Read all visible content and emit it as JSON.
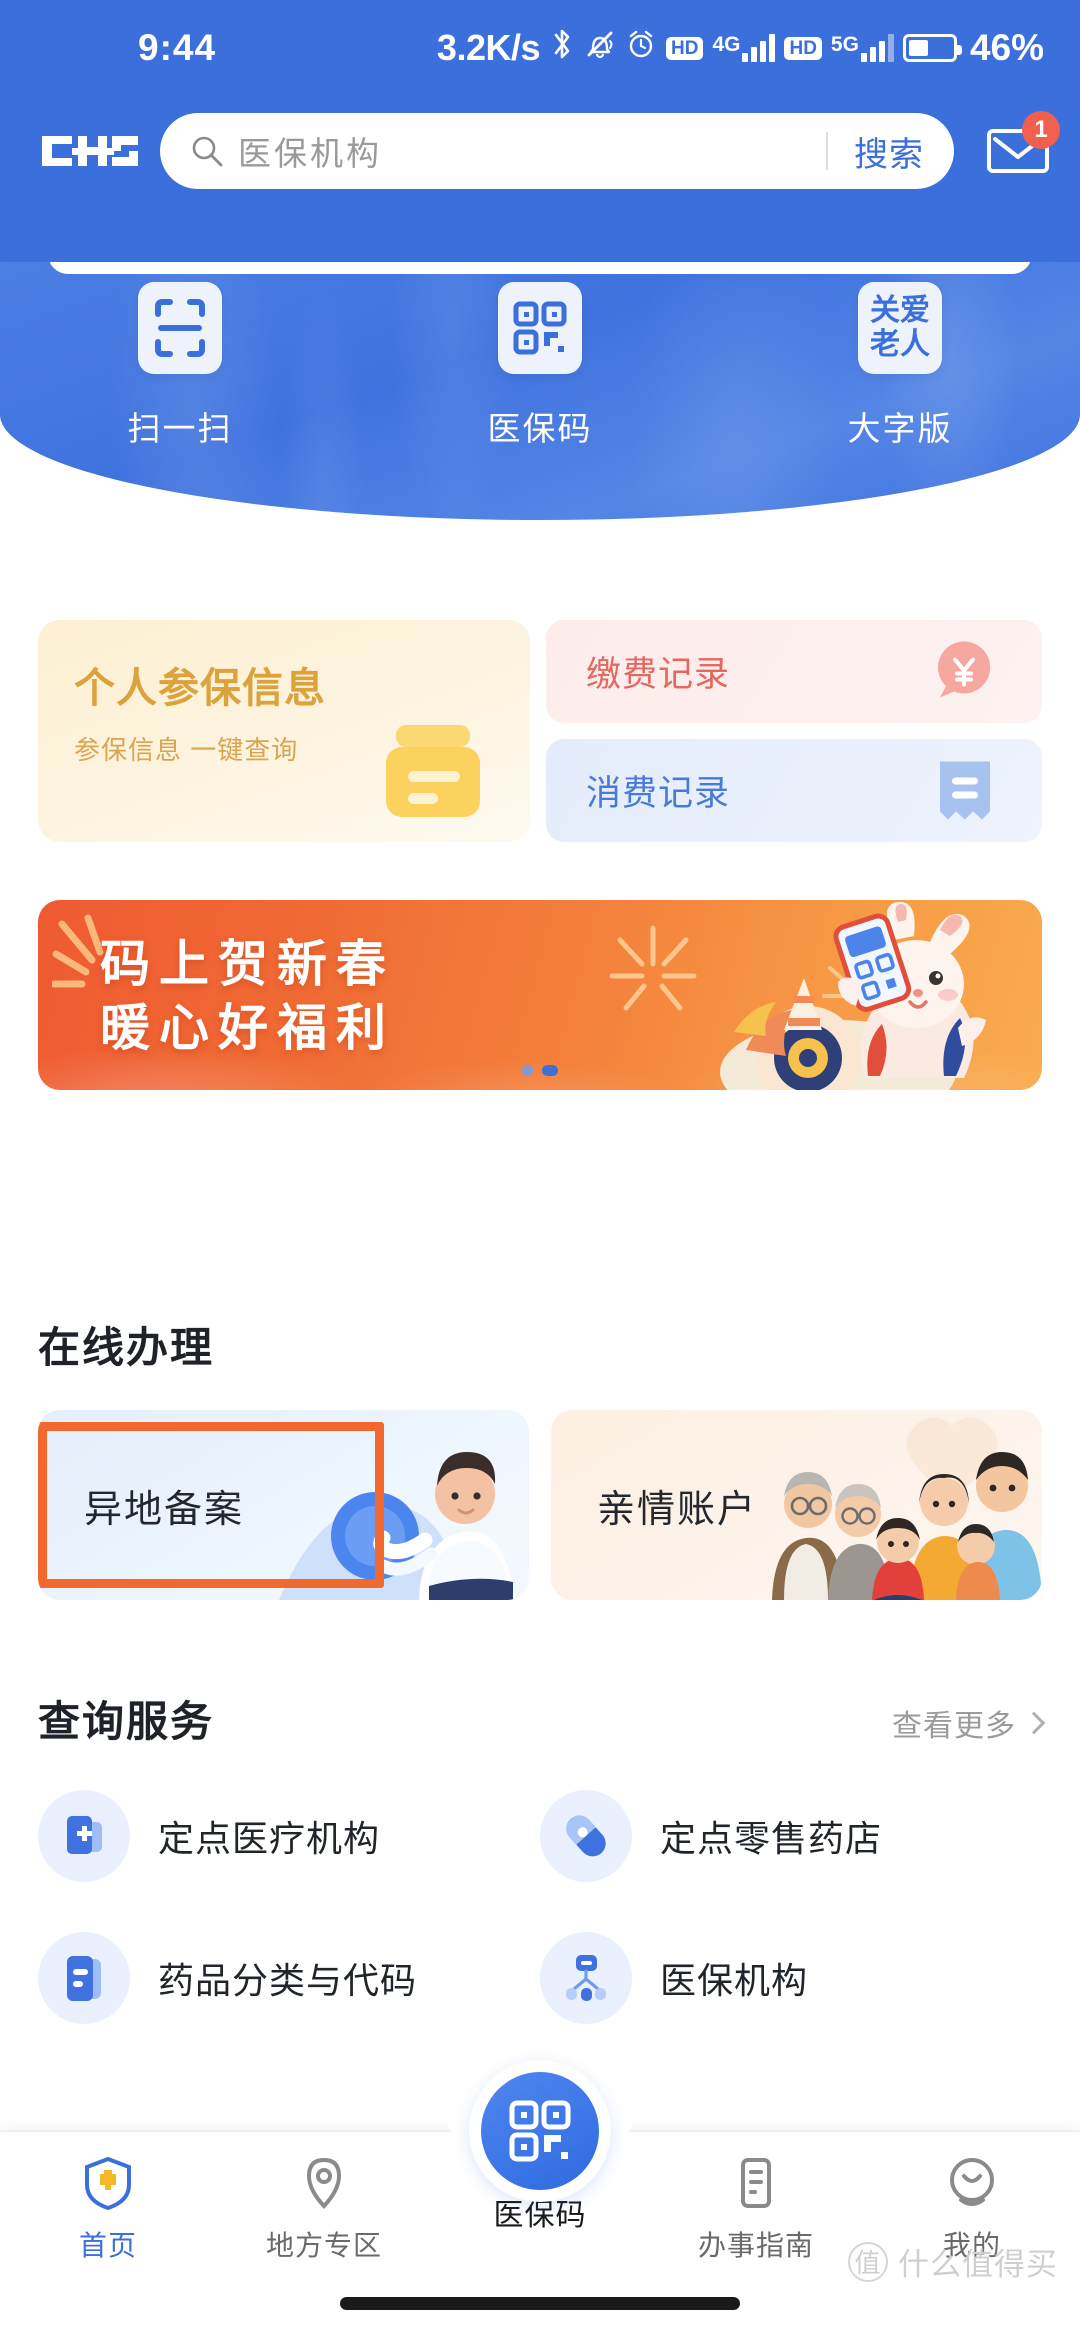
{
  "status_bar": {
    "time": "9:44",
    "network_speed": "3.2K/s",
    "icons": [
      "bluetooth-icon",
      "mute-vibrate-icon",
      "alarm-icon",
      "hd-icon",
      "signal-icon",
      "hd-icon",
      "signal-icon"
    ],
    "sim1_network": "4G",
    "sim2_network": "5G",
    "hd_label": "HD",
    "battery_percent": "46%",
    "battery_level": 46
  },
  "header": {
    "logo_text": "CHS",
    "search": {
      "placeholder": "医保机构",
      "value": "",
      "button_label": "搜索",
      "icon": "search-icon"
    },
    "mail": {
      "icon": "mail-icon",
      "badge_count": "1"
    }
  },
  "quick_actions": [
    {
      "label": "扫一扫",
      "icon": "scan-frame-icon"
    },
    {
      "label": "医保码",
      "icon": "qr-code-icon"
    },
    {
      "label": "大字版",
      "icon": "elder-care-icon",
      "icon_text_line1": "关爱",
      "icon_text_line2": "老人"
    }
  ],
  "info_cards": {
    "primary": {
      "title": "个人参保信息",
      "subtitle": "参保信息 一键查询",
      "icon": "insurance-card-icon",
      "accent": "#dca23c"
    },
    "secondary": [
      {
        "title": "缴费记录",
        "icon": "yuan-bubble-icon",
        "accent": "#e2695f"
      },
      {
        "title": "消费记录",
        "icon": "receipt-icon",
        "accent": "#4a7ad8"
      }
    ]
  },
  "banner": {
    "line1": "码上贺新春",
    "line2": "暖心好福利",
    "art": "new-year-rabbit-illustration",
    "dots_total": 2,
    "dots_active": 1
  },
  "online_section": {
    "title": "在线办理",
    "items": [
      {
        "label": "异地备案",
        "art": "man-holding-globe-illustration",
        "focused": true
      },
      {
        "label": "亲情账户",
        "art": "family-illustration",
        "focused": false
      }
    ]
  },
  "query_section": {
    "title": "查询服务",
    "more_label": "查看更多",
    "more_icon": "chevron-right-icon",
    "items": [
      {
        "label": "定点医疗机构",
        "icon": "hospital-cross-icon"
      },
      {
        "label": "定点零售药店",
        "icon": "pill-capsule-icon"
      },
      {
        "label": "药品分类与代码",
        "icon": "drug-catalog-icon"
      },
      {
        "label": "医保机构",
        "icon": "org-tree-icon"
      }
    ]
  },
  "tab_bar": {
    "items": [
      {
        "label": "首页",
        "icon": "shield-plus-icon",
        "active": true
      },
      {
        "label": "地方专区",
        "icon": "location-pin-icon",
        "active": false
      },
      {
        "label": "医保码",
        "icon": "qr-code-icon",
        "active": false,
        "is_center": true
      },
      {
        "label": "办事指南",
        "icon": "document-lines-icon",
        "active": false
      },
      {
        "label": "我的",
        "icon": "user-smiley-icon",
        "active": false
      }
    ],
    "active_color": "#3b6fdc"
  },
  "watermark": {
    "badge": "值",
    "text": "什么值得买"
  }
}
